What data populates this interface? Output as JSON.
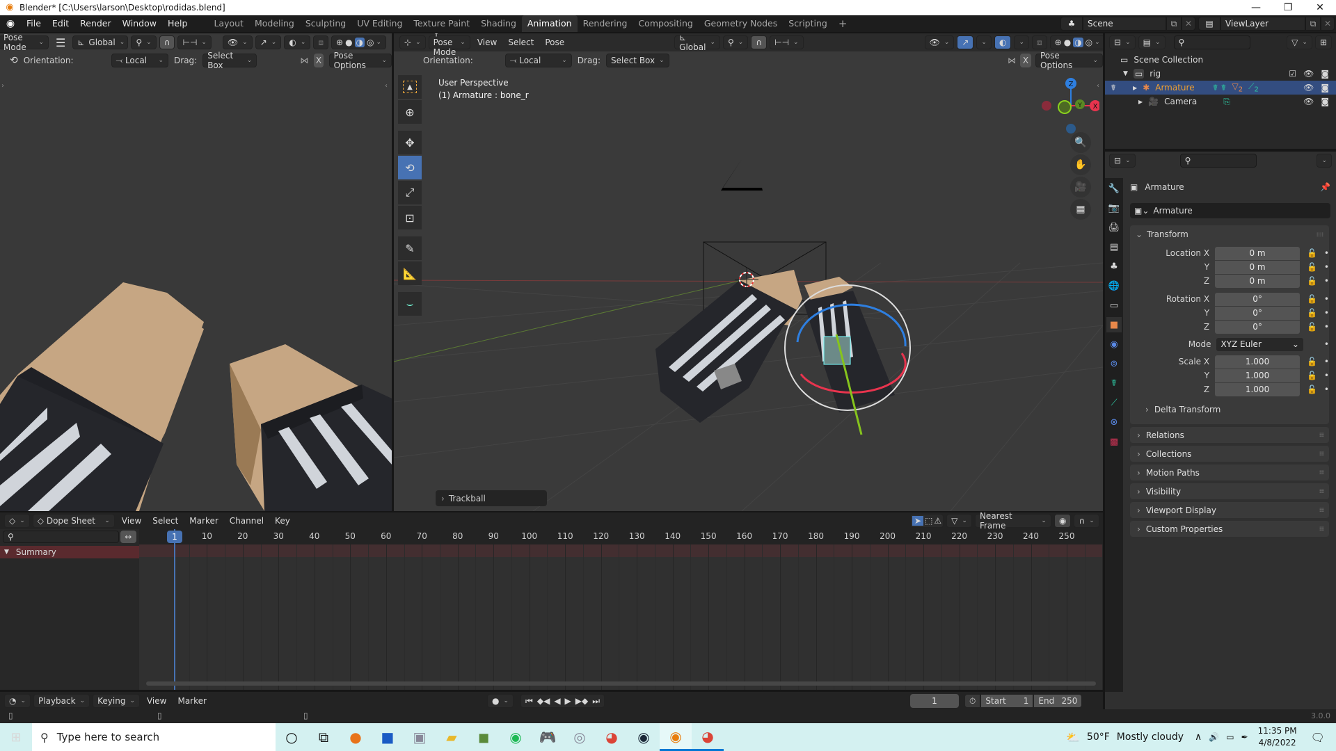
{
  "window": {
    "title": "Blender* [C:\\Users\\larson\\Desktop\\rodidas.blend]",
    "controls": {
      "minimize": "—",
      "maximize": "❐",
      "close": "✕"
    }
  },
  "topbar": {
    "menus": [
      "File",
      "Edit",
      "Render",
      "Window",
      "Help"
    ],
    "workspaces": [
      "Layout",
      "Modeling",
      "Sculpting",
      "UV Editing",
      "Texture Paint",
      "Shading",
      "Animation",
      "Rendering",
      "Compositing",
      "Geometry Nodes",
      "Scripting"
    ],
    "active_workspace": "Animation",
    "add_workspace": "+",
    "scene": "Scene",
    "view_layer": "ViewLayer"
  },
  "left_viewport": {
    "mode": "Pose Mode",
    "orientation_global": "Global",
    "orientation_label": "Orientation:",
    "orientation_value": "Local",
    "drag_label": "Drag:",
    "drag_value": "Select Box",
    "x_toggle": "X",
    "pose_options": "Pose Options"
  },
  "main_viewport": {
    "mode": "Pose Mode",
    "menus": [
      "View",
      "Select",
      "Pose"
    ],
    "orientation_global": "Global",
    "orientation_label": "Orientation:",
    "orientation_value": "Local",
    "drag_label": "Drag:",
    "drag_value": "Select Box",
    "x_toggle": "X",
    "pose_options": "Pose Options",
    "view_name": "User Perspective",
    "active_info": "(1) Armature : bone_r",
    "last_operator": "Trackball",
    "gizmo_axes": {
      "z": "Z",
      "y": "Y",
      "x": "X"
    },
    "axis_colors": {
      "x": "#e8344e",
      "y": "#6ba51b",
      "z": "#2e7fe0"
    }
  },
  "outliner": {
    "root": "Scene Collection",
    "items": [
      {
        "name": "rig",
        "type": "collection"
      },
      {
        "name": "Armature",
        "type": "armature",
        "selected": true,
        "badges": [
          "2",
          "2"
        ]
      },
      {
        "name": "Camera",
        "type": "camera"
      }
    ]
  },
  "properties": {
    "context": "Armature",
    "object_name": "Armature",
    "transform": {
      "title": "Transform",
      "location": {
        "label": "Location X",
        "x": "0 m",
        "y": "0 m",
        "z": "0 m"
      },
      "rotation": {
        "label": "Rotation X",
        "x": "0°",
        "y": "0°",
        "z": "0°"
      },
      "mode_label": "Mode",
      "mode_value": "XYZ Euler",
      "scale": {
        "label": "Scale X",
        "x": "1.000",
        "y": "1.000",
        "z": "1.000"
      },
      "axis_labels": {
        "y": "Y",
        "z": "Z"
      },
      "delta": "Delta Transform"
    },
    "panels": [
      "Relations",
      "Collections",
      "Motion Paths",
      "Visibility",
      "Viewport Display",
      "Custom Properties"
    ]
  },
  "dopesheet": {
    "mode": "Dope Sheet",
    "menus": [
      "View",
      "Select",
      "Marker",
      "Channel",
      "Key"
    ],
    "snap": "Nearest Frame",
    "current_frame_badge": "1",
    "frame_ticks": [
      "10",
      "20",
      "30",
      "40",
      "50",
      "60",
      "70",
      "80",
      "90",
      "100",
      "110",
      "120",
      "130",
      "140",
      "150",
      "160",
      "170",
      "180",
      "190",
      "200",
      "210",
      "220",
      "230",
      "240",
      "250"
    ],
    "summary_label": "Summary"
  },
  "timeline": {
    "menus": [
      "Playback",
      "Keying",
      "View",
      "Marker"
    ],
    "current_frame": "1",
    "start_label": "Start",
    "start_value": "1",
    "end_label": "End",
    "end_value": "250"
  },
  "statusbar": {
    "version": "3.0.0"
  },
  "taskbar": {
    "search_placeholder": "Type here to search",
    "weather_temp": "50°F",
    "weather_desc": "Mostly cloudy",
    "time": "11:35 PM",
    "date": "4/8/2022"
  }
}
